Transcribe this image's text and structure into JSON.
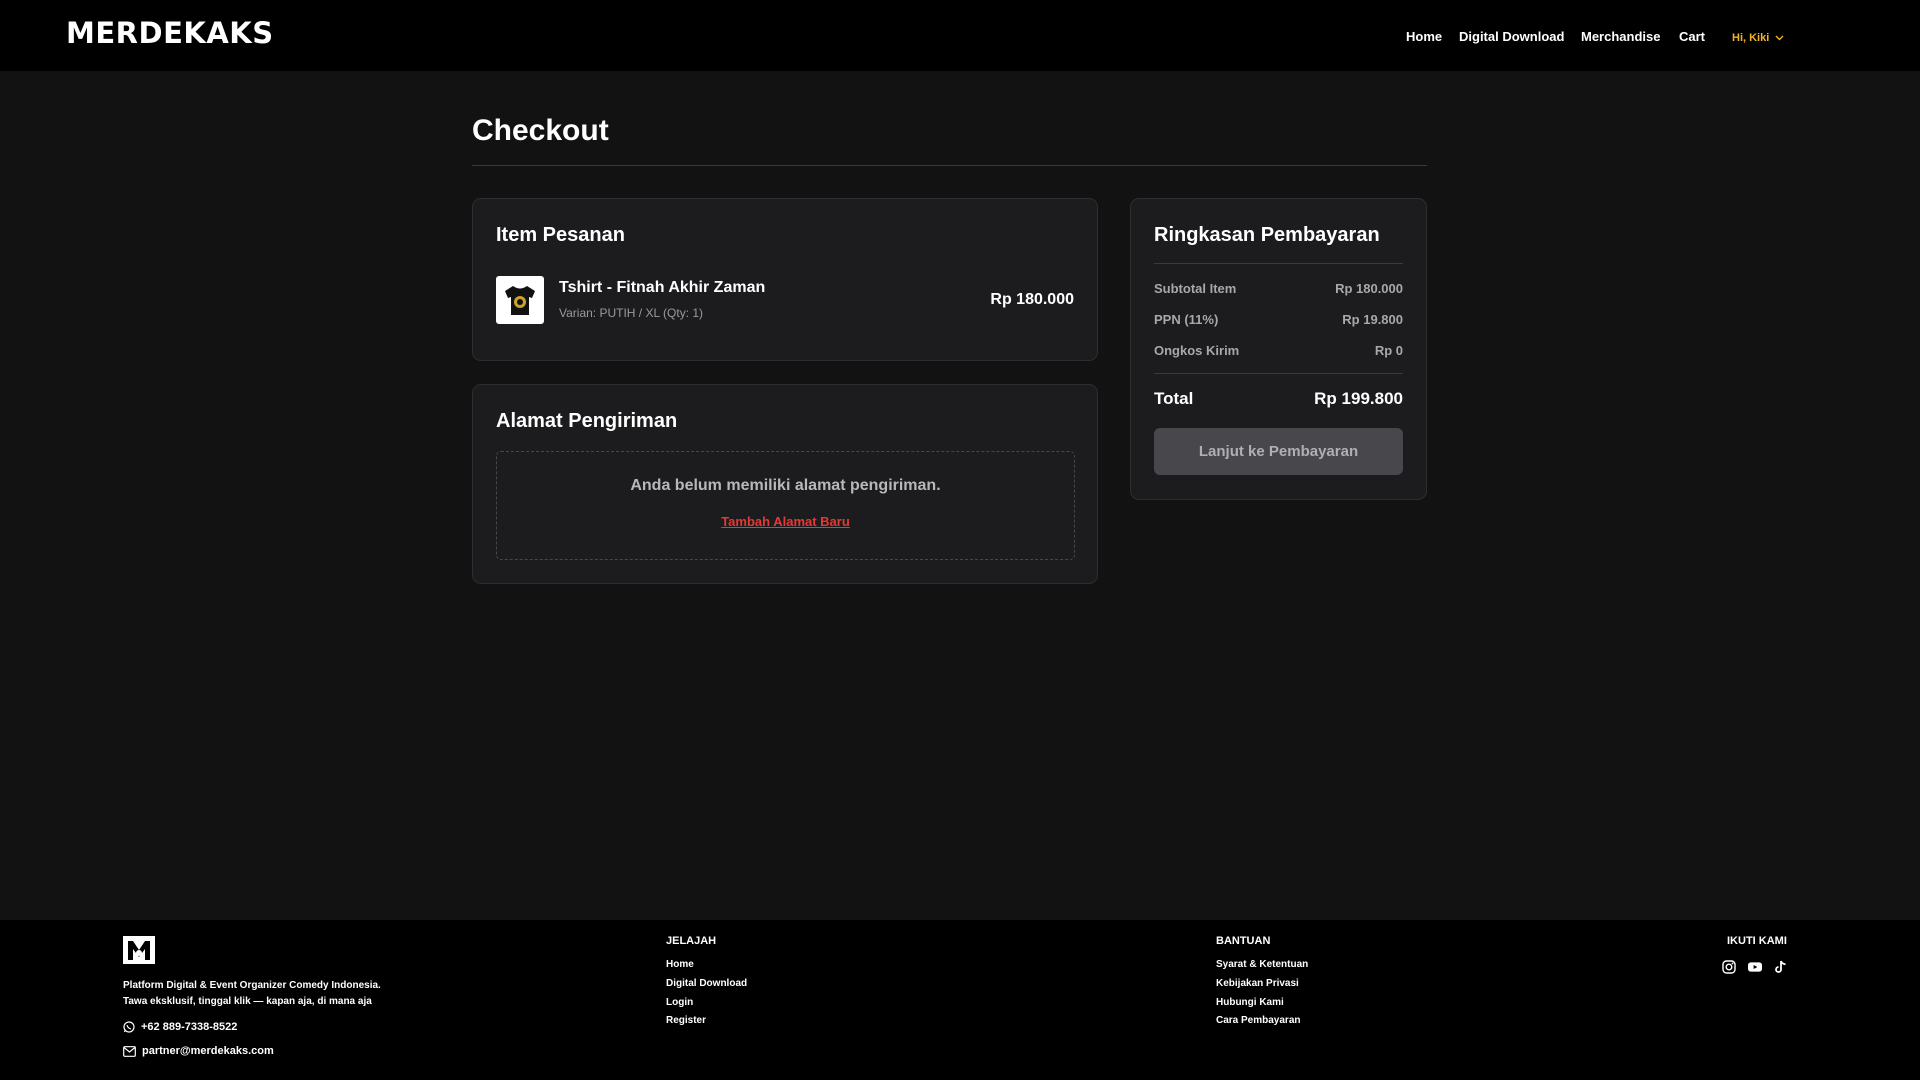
{
  "header": {
    "logo_text": "MERDEKAKS",
    "nav": {
      "home": "Home",
      "digital_download": "Digital Download",
      "merchandise": "Merchandise",
      "cart": "Cart",
      "user_greeting": "Hi, Kiki"
    }
  },
  "checkout": {
    "title": "Checkout",
    "items_card": {
      "title": "Item Pesanan",
      "items": [
        {
          "name": "Tshirt - Fitnah Akhir Zaman",
          "variant": "Varian: PUTIH / XL (Qty: 1)",
          "price": "Rp 180.000"
        }
      ]
    },
    "address_card": {
      "title": "Alamat Pengiriman",
      "empty_message": "Anda belum memiliki alamat pengiriman.",
      "add_link": "Tambah Alamat Baru"
    },
    "summary": {
      "title": "Ringkasan Pembayaran",
      "rows": [
        {
          "label": "Subtotal Item",
          "value": "Rp 180.000"
        },
        {
          "label": "PPN (11%)",
          "value": "Rp 19.800"
        },
        {
          "label": "Ongkos Kirim",
          "value": "Rp 0"
        }
      ],
      "total_label": "Total",
      "total_value": "Rp 199.800",
      "pay_button": "Lanjut ke Pembayaran"
    }
  },
  "footer": {
    "tagline_line1": "Platform Digital & Event Organizer Comedy Indonesia.",
    "tagline_line2": "Tawa eksklusif, tinggal klik — kapan aja, di mana aja",
    "phone": "+62 889-7338-8522",
    "email": "partner@merdekaks.com",
    "explore": {
      "title": "JELAJAH",
      "links": [
        "Home",
        "Digital Download",
        "Login",
        "Register"
      ]
    },
    "help": {
      "title": "BANTUAN",
      "links": [
        "Syarat & Ketentuan",
        "Kebijakan Privasi",
        "Hubungi Kami",
        "Cara Pembayaran"
      ]
    },
    "follow": {
      "title": "IKUTI KAMI",
      "icons": [
        "instagram-icon",
        "youtube-icon",
        "tiktok-icon"
      ]
    }
  },
  "colors": {
    "background": "#121212",
    "card": "#1c1c1e",
    "accent_user": "#f0b429",
    "link_red": "#e53935"
  }
}
